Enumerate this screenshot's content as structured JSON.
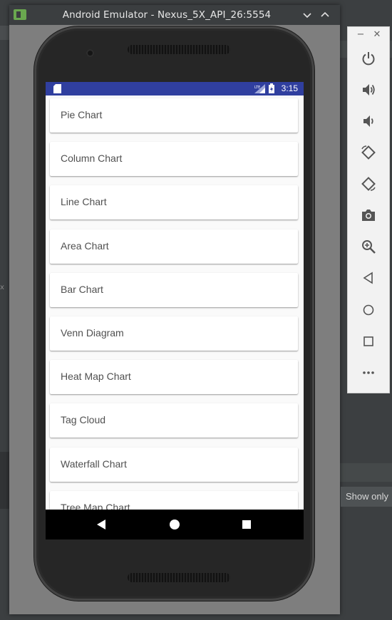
{
  "window": {
    "title": "Android Emulator - Nexus_5X_API_26:5554"
  },
  "status_bar": {
    "time": "3:15",
    "network": "LTE"
  },
  "chart_list": {
    "items": [
      "Pie Chart",
      "Column Chart",
      "Line Chart",
      "Area Chart",
      "Bar Chart",
      "Venn Diagram",
      "Heat Map Chart",
      "Tag Cloud",
      "Waterfall Chart",
      "Tree Map Chart"
    ]
  },
  "ide": {
    "show_only_label": "Show only",
    "x_marker": "x"
  },
  "colors": {
    "status_bar": "#303f9f",
    "card_text": "#505050",
    "toolbar_icon": "#555555",
    "ide_background": "#3c3f41"
  },
  "side_toolbar": {
    "minimize": "−",
    "close": "✕",
    "tools": [
      "power-icon",
      "volume-up-icon",
      "volume-down-icon",
      "rotate-left-icon",
      "rotate-right-icon",
      "camera-icon",
      "zoom-icon",
      "back-icon",
      "home-icon",
      "overview-icon",
      "more-icon"
    ]
  }
}
